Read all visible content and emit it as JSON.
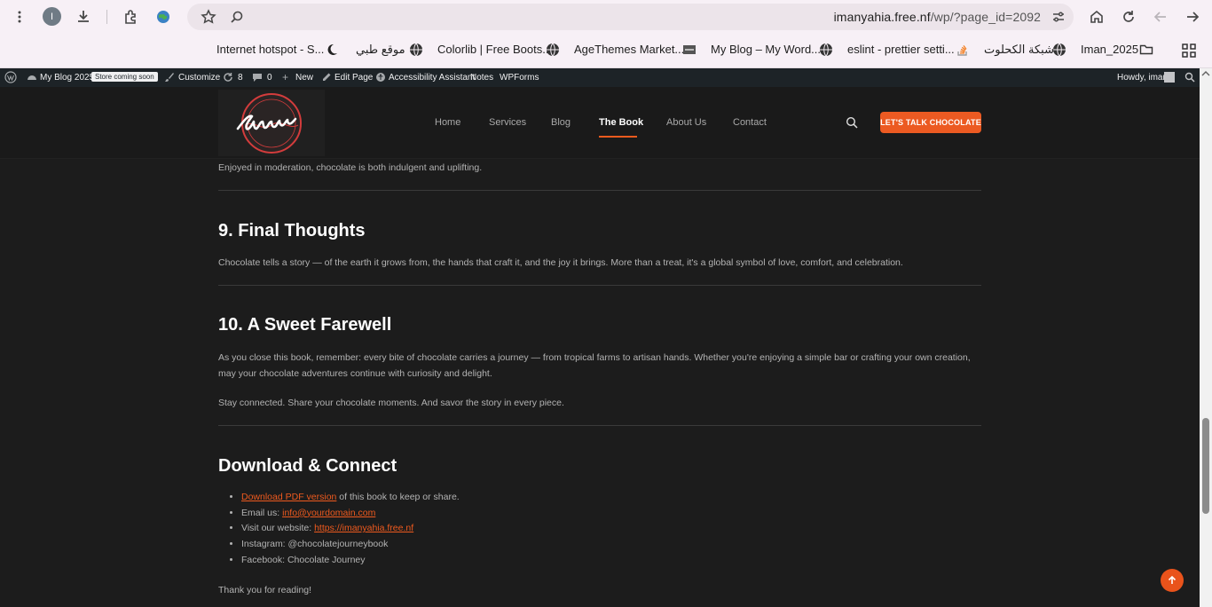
{
  "browser": {
    "url_host": "imanyahia.free.nf",
    "url_path": "/wp/?page_id=2092",
    "profile_initial": "I"
  },
  "bookmarks": [
    {
      "label": "Internet hotspot - S...",
      "icon": "moon-icon"
    },
    {
      "label": "موقع طبي",
      "icon": "globe-icon"
    },
    {
      "label": "Colorlib | Free Boots...",
      "icon": "globe-icon"
    },
    {
      "label": "AgeThemes Market...",
      "icon": "agethemes-icon"
    },
    {
      "label": "My Blog – My Word...",
      "icon": "globe-icon"
    },
    {
      "label": "eslint - prettier setti...",
      "icon": "stackoverflow-icon"
    },
    {
      "label": "شبكة الكحلوت",
      "icon": "globe-icon"
    },
    {
      "label": "Iman_2025",
      "icon": "folder-icon"
    }
  ],
  "adminbar": {
    "site_name": "My Blog 2025",
    "badge": "Store coming soon",
    "customize": "Customize",
    "updates": "8",
    "comments": "0",
    "new": "New",
    "edit_page": "Edit Page",
    "accessibility": "Accessibility Assistant",
    "notes": "Notes",
    "wpforms": "WPForms",
    "howdy": "Howdy, iman"
  },
  "nav": {
    "items": [
      "Home",
      "Services",
      "Blog",
      "The Book",
      "About Us",
      "Contact"
    ],
    "active": "The Book",
    "cta": "LET'S TALK CHOCOLATE"
  },
  "content": {
    "intro": "Enjoyed in moderation, chocolate is both indulgent and uplifting.",
    "s9_title": "9. Final Thoughts",
    "s9_p": "Chocolate tells a story — of the earth it grows from, the hands that craft it, and the joy it brings. More than a treat, it's a global symbol of love, comfort, and celebration.",
    "s10_title": "10. A Sweet Farewell",
    "s10_p1_l1": "As you close this book, remember: every bite of chocolate carries a journey — from tropical farms to artisan hands. Whether you're enjoying a simple bar or crafting your own creation,",
    "s10_p1_l2": "may your chocolate adventures continue with curiosity and delight.",
    "s10_p2": "Stay connected. Share your chocolate moments. And savor the story in every piece.",
    "dl_title": "Download & Connect",
    "links": {
      "pdf_link": "Download PDF version",
      "pdf_rest": " of this book to keep or share.",
      "email_label": "Email us: ",
      "email_link": "info@yourdomain.com",
      "site_label": "Visit our website: ",
      "site_link": "https://imanyahia.free.nf",
      "instagram": "Instagram: @chocolatejourneybook",
      "facebook": "Facebook: Chocolate Journey"
    },
    "thanks": "Thank you for reading!"
  },
  "colors": {
    "accent": "#ec5a22",
    "page_bg": "#1c1c1c",
    "adminbar_bg": "#1d2327"
  }
}
